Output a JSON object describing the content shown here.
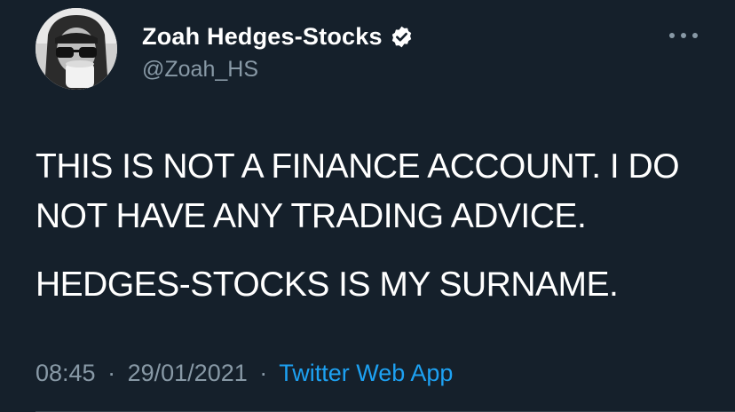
{
  "tweet": {
    "display_name": "Zoah Hedges-Stocks",
    "handle": "@Zoah_HS",
    "paragraphs": [
      "THIS IS NOT A FINANCE ACCOUNT. I DO NOT HAVE ANY TRADING ADVICE.",
      "HEDGES-STOCKS IS MY SURNAME."
    ],
    "time": "08:45",
    "date": "29/01/2021",
    "separator": "·",
    "source": "Twitter Web App"
  },
  "icons": {
    "verified": "verified-badge-icon",
    "more": "more-options-icon"
  },
  "colors": {
    "background": "#15202b",
    "text_primary": "#ffffff",
    "text_secondary": "#8899a6",
    "link": "#1da1f2"
  }
}
